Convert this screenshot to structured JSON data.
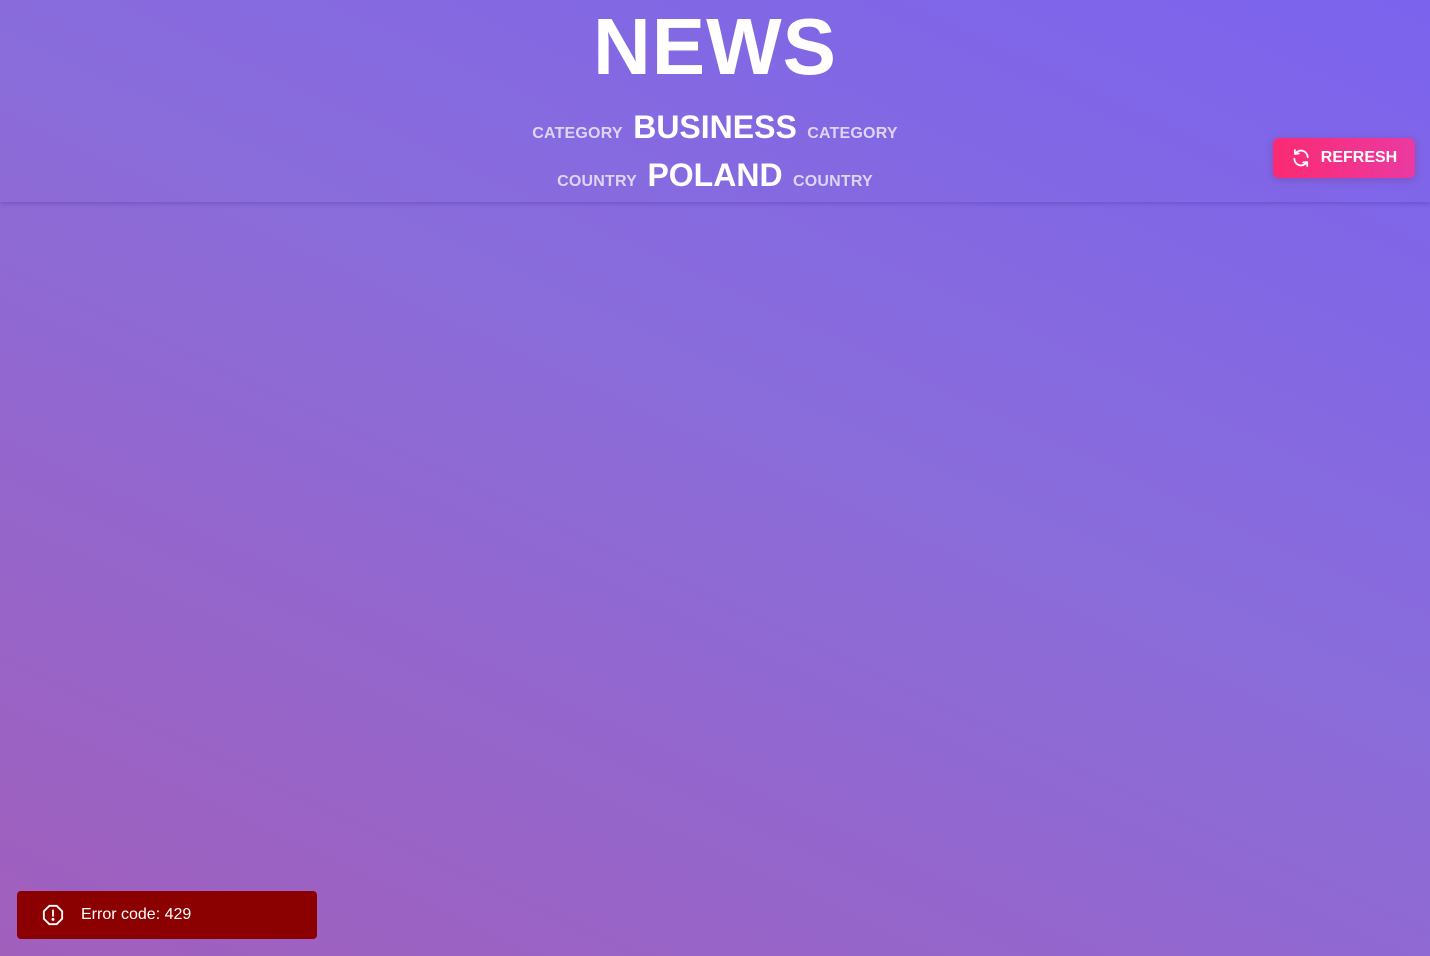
{
  "header": {
    "title": "NEWS",
    "category": {
      "label_left": "CATEGORY",
      "value": "BUSINESS",
      "label_right": "CATEGORY"
    },
    "country": {
      "label_left": "COUNTRY",
      "value": "POLAND",
      "label_right": "COUNTRY"
    }
  },
  "refresh_button": {
    "label": "REFRESH",
    "icon": "refresh-icon",
    "color_start": "#fb2a72",
    "color_end": "#ea3aa2"
  },
  "toast": {
    "icon": "alert-circle-icon",
    "message": "Error code: 429",
    "background": "#8b0000"
  },
  "colors": {
    "background_top": "#7b63ee",
    "background_bottom": "#a15fbc"
  }
}
